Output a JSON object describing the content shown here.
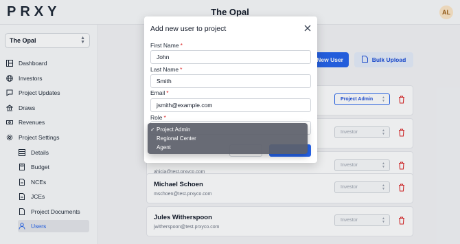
{
  "app": {
    "logo": "PRXY",
    "project_title": "The Opal",
    "avatar_initials": "AL"
  },
  "sidebar": {
    "project_select": "The Opal",
    "items": [
      {
        "label": "Dashboard",
        "icon": "dashboard-icon"
      },
      {
        "label": "Investors",
        "icon": "globe-icon"
      },
      {
        "label": "Project Updates",
        "icon": "chat-icon"
      },
      {
        "label": "Draws",
        "icon": "bank-icon"
      },
      {
        "label": "Revenues",
        "icon": "cash-icon"
      },
      {
        "label": "Project Settings",
        "icon": "gear-icon"
      }
    ],
    "sub_items": [
      {
        "label": "Details",
        "icon": "grid-icon"
      },
      {
        "label": "Budget",
        "icon": "calculator-icon"
      },
      {
        "label": "NCEs",
        "icon": "document-edit-icon"
      },
      {
        "label": "JCEs",
        "icon": "document-edit-icon"
      },
      {
        "label": "Project Documents",
        "icon": "document-icon"
      },
      {
        "label": "Users",
        "icon": "user-icon",
        "active": true
      }
    ]
  },
  "main": {
    "new_user_label": "New User",
    "bulk_upload_label": "Bulk Upload",
    "users": [
      {
        "name": "",
        "email": "",
        "role": "Project Admin"
      },
      {
        "name": "",
        "email": "",
        "role": "Investor"
      },
      {
        "name": "",
        "email": "ahicia@test.prxyco.com",
        "role": "Investor"
      },
      {
        "name": "Michael Schoen",
        "email": "mschoen@test.prxyco.com",
        "role": "Investor"
      },
      {
        "name": "Jules Witherspoon",
        "email": "jwitherspoon@test.prxyco.com",
        "role": "Investor"
      }
    ]
  },
  "modal": {
    "title": "Add new user to project",
    "first_name_label": "First Name",
    "first_name_value": "John",
    "last_name_label": "Last Name",
    "last_name_value": "Smith",
    "email_label": "Email",
    "email_value": "jsmith@example.com",
    "role_label": "Role",
    "required_mark": "*",
    "role_options": [
      {
        "label": "Project Admin",
        "selected": true
      },
      {
        "label": "Regional Center",
        "selected": false
      },
      {
        "label": "Agent",
        "selected": false
      }
    ],
    "check_mark": "✓"
  },
  "colors": {
    "accent": "#2563eb",
    "danger": "#dc2626",
    "required": "#dc2626"
  }
}
